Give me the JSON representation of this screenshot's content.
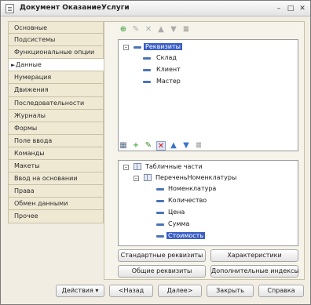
{
  "window": {
    "title": "Документ ОказаниеУслуги"
  },
  "titlebar": {
    "minimize": "–",
    "restore": "□",
    "close": "✕"
  },
  "sidebar": {
    "items": [
      {
        "label": "Основные"
      },
      {
        "label": "Подсистемы"
      },
      {
        "label": "Функциональные опции"
      },
      {
        "label": "Данные",
        "active": true
      },
      {
        "label": "Нумерация"
      },
      {
        "label": "Движения"
      },
      {
        "label": "Последовательности"
      },
      {
        "label": "Журналы"
      },
      {
        "label": "Формы"
      },
      {
        "label": "Поле ввода"
      },
      {
        "label": "Команды"
      },
      {
        "label": "Макеты"
      },
      {
        "label": "Ввод на основании"
      },
      {
        "label": "Права"
      },
      {
        "label": "Обмен данными"
      },
      {
        "label": "Прочее"
      }
    ],
    "active_marker": "►"
  },
  "attributes_tree": {
    "root": "Реквизиты",
    "children": [
      "Склад",
      "Клиент",
      "Мастер"
    ]
  },
  "tabular_tree": {
    "root": "Табличные части",
    "section": "ПереченьНоменклатуры",
    "children": [
      "Номенклатура",
      "Количество",
      "Цена",
      "Сумма",
      "Стоимость"
    ]
  },
  "content_buttons": {
    "standard_attributes": "Стандартные реквизиты",
    "characteristics": "Характеристики",
    "common_attributes": "Общие реквизиты",
    "extra_indexes": "Дополнительные индексы"
  },
  "footer": {
    "actions": "Действия",
    "actions_arrow": "▾",
    "back": "<Назад",
    "next": "Далее>",
    "close": "Закрыть",
    "help": "Справка"
  }
}
